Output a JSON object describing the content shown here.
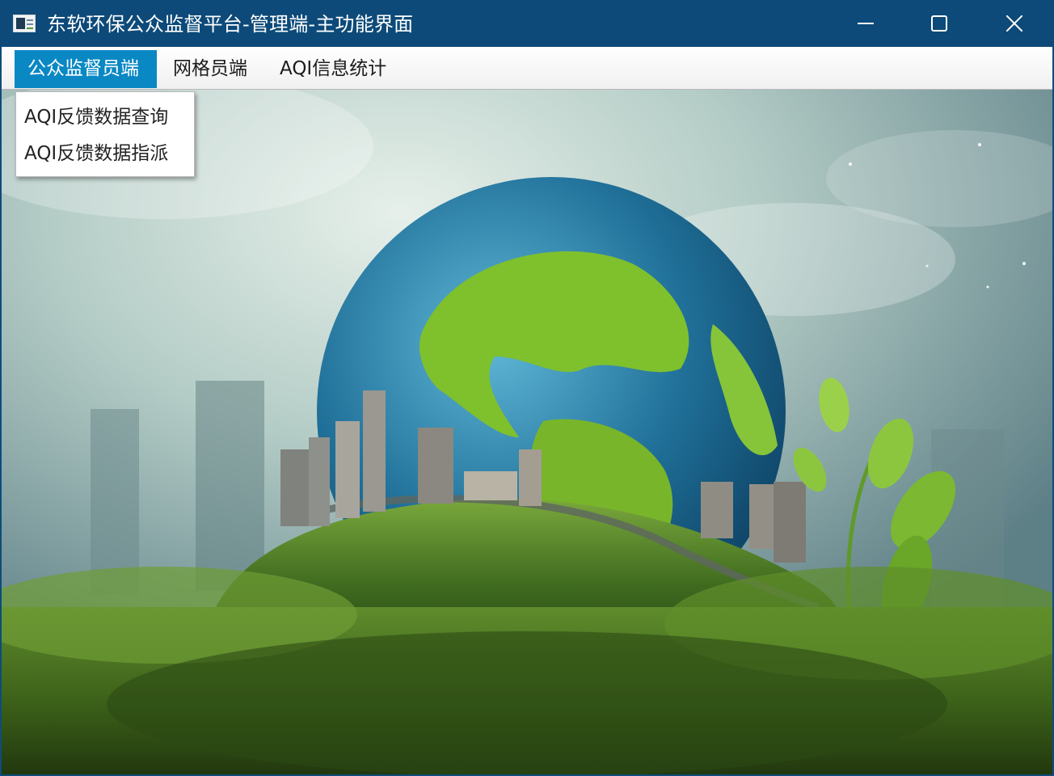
{
  "window": {
    "title": "东软环保公众监督平台-管理端-主功能界面",
    "titlebar_color": "#0d4a79"
  },
  "menubar": {
    "items": [
      {
        "label": "公众监督员端",
        "active": true
      },
      {
        "label": "网格员端",
        "active": false
      },
      {
        "label": "AQI信息统计",
        "active": false
      }
    ],
    "active_color": "#0a88c4"
  },
  "dropdown": {
    "items": [
      {
        "label": "AQI反馈数据查询"
      },
      {
        "label": "AQI反馈数据指派"
      }
    ]
  },
  "icons": {
    "app": "app-window-icon",
    "minimize": "minimize-icon",
    "maximize": "maximize-icon",
    "close": "close-icon"
  }
}
